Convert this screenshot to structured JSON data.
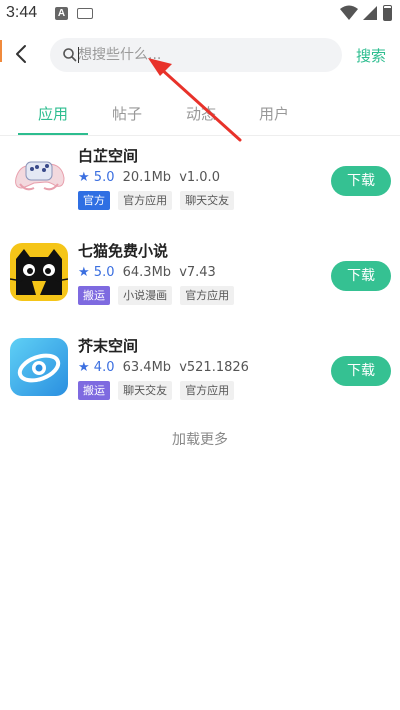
{
  "status_bar": {
    "time": "3:44",
    "notif_a": "A"
  },
  "header": {
    "search_placeholder": "想搜些什么...",
    "search_button": "搜索"
  },
  "tabs": [
    {
      "label": "应用",
      "active": true
    },
    {
      "label": "帖子",
      "active": false
    },
    {
      "label": "动态",
      "active": false
    },
    {
      "label": "用户",
      "active": false
    }
  ],
  "apps": [
    {
      "name": "白芷空间",
      "rating": "5.0",
      "size": "20.1Mb",
      "version": "v1.0.0",
      "tags": [
        "官方",
        "官方应用",
        "聊天交友"
      ],
      "download": "下载",
      "icon": "gamepad-hands-icon"
    },
    {
      "name": "七猫免费小说",
      "rating": "5.0",
      "size": "64.3Mb",
      "version": "v7.43",
      "tags": [
        "搬运",
        "小说漫画",
        "官方应用"
      ],
      "download": "下载",
      "icon": "black-cat-icon"
    },
    {
      "name": "芥末空间",
      "rating": "4.0",
      "size": "63.4Mb",
      "version": "v521.1826",
      "tags": [
        "搬运",
        "聊天交友",
        "官方应用"
      ],
      "download": "下载",
      "icon": "swirl-planet-icon"
    }
  ],
  "load_more": "加载更多",
  "colors": {
    "accent": "#2dbd8f",
    "download_bg": "#35c192",
    "official_tag": "#2f6fe3",
    "port_tag": "#7e6ae0",
    "star": "#3b6fe0",
    "annotation": "#e8322a"
  }
}
